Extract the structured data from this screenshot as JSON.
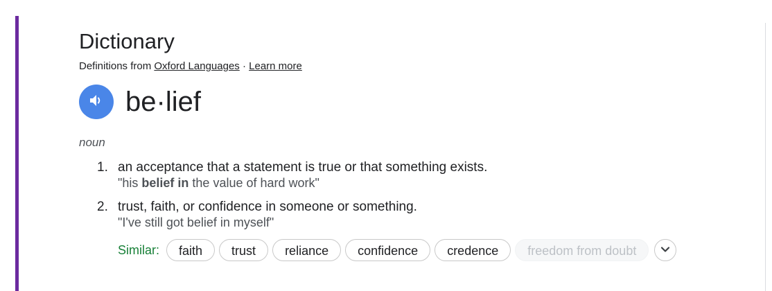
{
  "card": {
    "title": "Dictionary",
    "source_prefix": "Definitions from ",
    "source_link": "Oxford Languages",
    "separator": " · ",
    "learn_more": "Learn more"
  },
  "entry": {
    "headword": "be·lief",
    "part_of_speech": "noun",
    "definitions": [
      {
        "number": "1.",
        "text": "an acceptance that a statement is true or that something exists.",
        "example_open": "\"his ",
        "example_bold": "belief in",
        "example_close": " the value of hard work\""
      },
      {
        "number": "2.",
        "text": "trust, faith, or confidence in someone or something.",
        "example": "\"I've still got belief in myself\""
      }
    ],
    "similar": {
      "label": "Similar:",
      "words": [
        "faith",
        "trust",
        "reliance",
        "confidence",
        "credence"
      ],
      "faded_word": "freedom from doubt"
    }
  },
  "icons": {
    "speaker": "speaker-icon",
    "expand": "chevron-down-icon"
  },
  "colors": {
    "accent_bar": "#6b2a9f",
    "speaker_bg": "#4a86e8",
    "similar_label": "#188038"
  }
}
